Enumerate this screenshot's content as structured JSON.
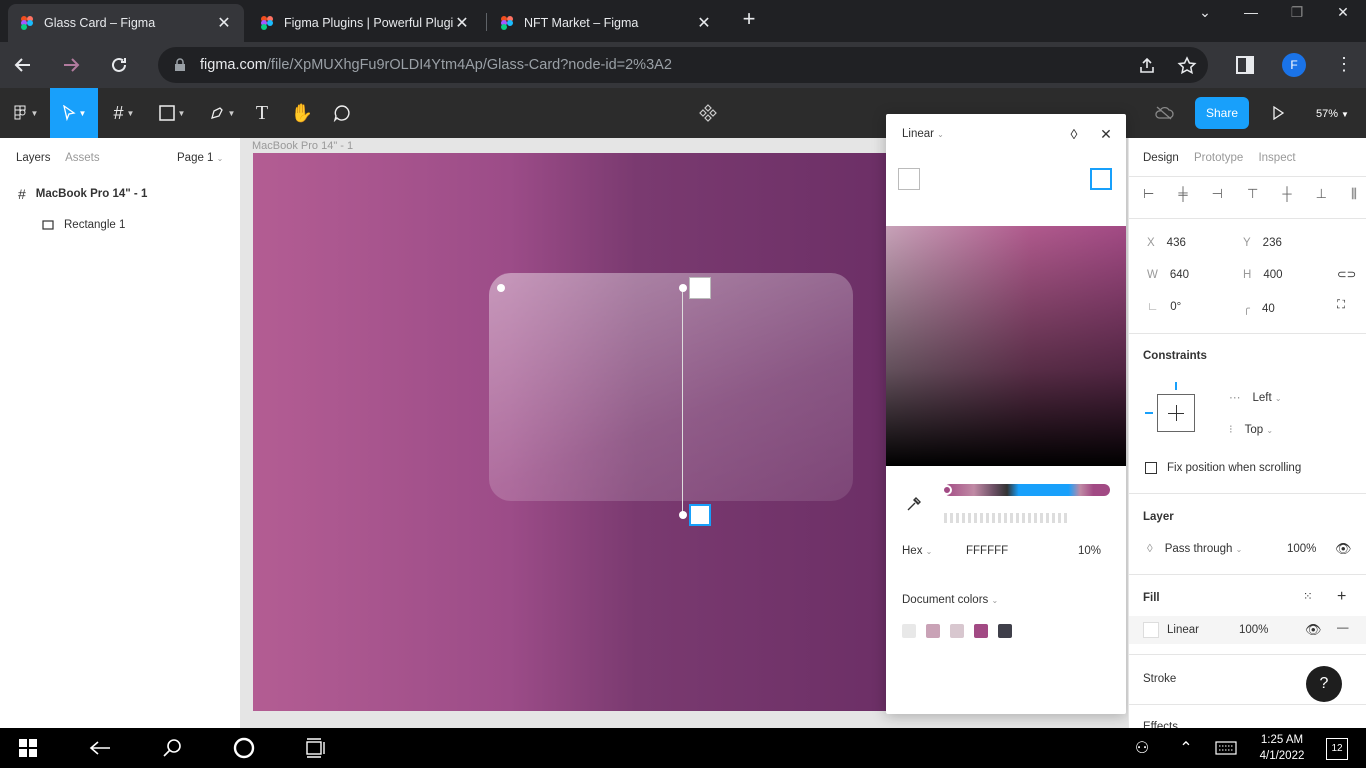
{
  "browser": {
    "tabs": [
      {
        "title": "Glass Card – Figma",
        "active": true
      },
      {
        "title": "Figma Plugins | Powerful Plugi",
        "active": false
      },
      {
        "title": "NFT Market – Figma",
        "active": false
      }
    ],
    "url_host": "figma.com",
    "url_path": "/file/XpMUXhgFu9rOLDI4Ytm4Ap/Glass-Card?node-id=2%3A2",
    "profile_initial": "F"
  },
  "figma_toolbar": {
    "share_label": "Share",
    "zoom": "57%"
  },
  "left_panel": {
    "tabs": [
      "Layers",
      "Assets"
    ],
    "page": "Page 1",
    "layers": [
      {
        "name": "MacBook Pro 14\" - 1",
        "icon": "frame-icon"
      },
      {
        "name": "Rectangle 1",
        "icon": "rectangle-icon"
      }
    ]
  },
  "canvas": {
    "frame_label": "MacBook Pro 14\" - 1"
  },
  "fill_picker": {
    "type": "Linear",
    "color_mode": "Hex",
    "hex": "FFFFFF",
    "opacity": "10%",
    "document_colors_label": "Document colors",
    "document_colors": [
      "#e8e8e8",
      "#c9a2b6",
      "#d8c7cf",
      "#a24a84",
      "#3f3f4a"
    ]
  },
  "right_panel": {
    "tabs": [
      "Design",
      "Prototype",
      "Inspect"
    ],
    "x": "436",
    "y": "236",
    "w": "640",
    "h": "400",
    "rotation": "0°",
    "radius": "40",
    "constraints_label": "Constraints",
    "constraint_h": "Left",
    "constraint_v": "Top",
    "fix_position_label": "Fix position when scrolling",
    "layer_label": "Layer",
    "blend_mode": "Pass through",
    "layer_opacity": "100%",
    "fill_label": "Fill",
    "fill_type": "Linear",
    "fill_opacity": "100%",
    "stroke_label": "Stroke",
    "effects_label": "Effects"
  },
  "taskbar": {
    "time": "1:25 AM",
    "date": "4/1/2022",
    "notifications": "12"
  }
}
